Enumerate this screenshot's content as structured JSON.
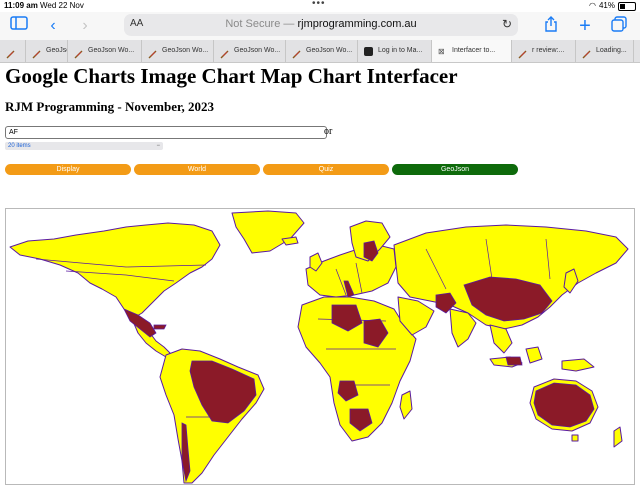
{
  "status_bar": {
    "time": "11:09 am",
    "date": "Wed 22 Nov",
    "battery": "41%"
  },
  "browser": {
    "url_prefix": "Not Secure —",
    "url_host": "rjmprogramming.com.au",
    "text_size_label": "AA",
    "tabs": [
      {
        "label": "",
        "favicon": "feather-icon"
      },
      {
        "label": "GeoJson",
        "favicon": "feather-icon"
      },
      {
        "label": "GeoJson Wo...",
        "favicon": "feather-icon"
      },
      {
        "label": "GeoJson Wo...",
        "favicon": "feather-icon"
      },
      {
        "label": "GeoJson Wo...",
        "favicon": "feather-icon"
      },
      {
        "label": "GeoJson Wo...",
        "favicon": "feather-icon"
      },
      {
        "label": "Log in to Ma...",
        "favicon": "square-logo-icon"
      },
      {
        "label": "Interfacer to...",
        "favicon": "close-icon"
      },
      {
        "label": "r review:...",
        "favicon": "feather-icon"
      },
      {
        "label": "Loading...",
        "favicon": "feather-icon"
      }
    ],
    "active_tab": 7
  },
  "page": {
    "title": "Google Charts Image Chart Map Chart Interfacer",
    "subtitle": "RJM Programming - November, 2023",
    "country_input_value": "AF",
    "or_text": "or",
    "items_select": "20 items",
    "buttons": {
      "display": "Display",
      "world": "World",
      "quiz": "Quiz",
      "geojson": "GeoJson"
    }
  },
  "colors": {
    "land": "#ffff00",
    "highlight": "#8b1a28",
    "border": "#5a1aa0",
    "button_orange": "#f39b16",
    "button_green": "#0e6a0b",
    "browser_blue": "#1a7cf5"
  }
}
